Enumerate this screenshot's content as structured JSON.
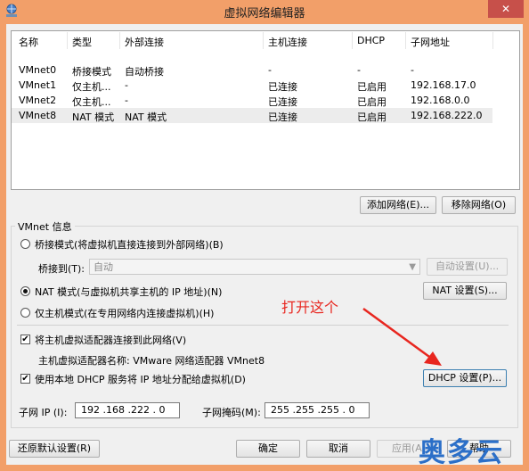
{
  "window": {
    "title": "虚拟网络编辑器",
    "close_label": "✕"
  },
  "table": {
    "columns": [
      "名称",
      "类型",
      "外部连接",
      "主机连接",
      "DHCP",
      "子网地址"
    ],
    "rows": [
      [
        "VMnet0",
        "桥接模式",
        "自动桥接",
        "-",
        "-",
        "-"
      ],
      [
        "VMnet1",
        "仅主机...",
        "-",
        "已连接",
        "已启用",
        "192.168.17.0"
      ],
      [
        "VMnet2",
        "仅主机...",
        "-",
        "已连接",
        "已启用",
        "192.168.0.0"
      ],
      [
        "VMnet8",
        "NAT 模式",
        "NAT 模式",
        "已连接",
        "已启用",
        "192.168.222.0"
      ]
    ],
    "selected_row": 3
  },
  "buttons": {
    "add_network": "添加网络(E)...",
    "remove_network": "移除网络(O)",
    "auto_settings": "自动设置(U)...",
    "nat_settings": "NAT 设置(S)...",
    "dhcp_settings": "DHCP 设置(P)...",
    "restore_defaults": "还原默认设置(R)",
    "ok": "确定",
    "cancel": "取消",
    "apply": "应用(A)",
    "help": "帮助"
  },
  "vmnet_info": {
    "group_label": "VMnet 信息",
    "bridged_radio": "桥接模式(将虚拟机直接连接到外部网络)(B)",
    "bridged_to_label": "桥接到(T):",
    "bridged_to_value": "自动",
    "nat_radio": "NAT 模式(与虚拟机共享主机的 IP 地址)(N)",
    "hostonly_radio": "仅主机模式(在专用网络内连接虚拟机)(H)",
    "selected_mode": "nat",
    "connect_adapter_checkbox": "将主机虚拟适配器连接到此网络(V)",
    "connect_adapter_checked": true,
    "adapter_name_text": "主机虚拟适配器名称: VMware 网络适配器 VMnet8",
    "dhcp_checkbox": "使用本地 DHCP 服务将 IP 地址分配给虚拟机(D)",
    "dhcp_checked": true,
    "subnet_ip_label": "子网 IP (I):",
    "subnet_ip_value": "192 .168 .222 . 0",
    "subnet_mask_label": "子网掩码(M):",
    "subnet_mask_value": "255 .255 .255 . 0"
  },
  "annotation": {
    "text": "打开这个",
    "color": "#e8261f"
  },
  "watermark": {
    "text": "奥多云"
  },
  "colors": {
    "titlebar": "#f29f69",
    "close_button": "#c7504a",
    "selected_row": "#ececec"
  }
}
